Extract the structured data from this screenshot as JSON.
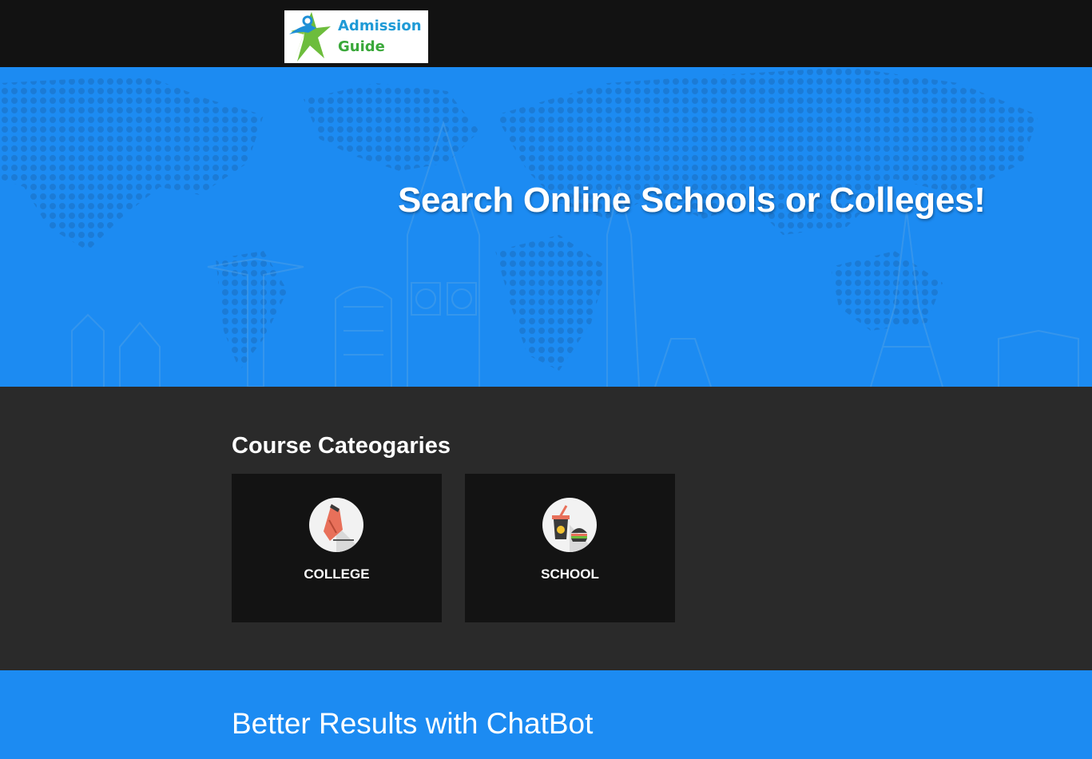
{
  "header": {
    "logo": {
      "line1": "Admission",
      "line2": "Guide",
      "icon": "star-person-logo-icon",
      "colors": {
        "blue": "#1e9ad6",
        "green": "#3aa83a"
      }
    }
  },
  "hero": {
    "title": "Search Online Schools or Colleges!",
    "background_color": "#1c8bf2",
    "background_art": "dotted-world-map-with-landmarks"
  },
  "categories": {
    "heading": "Course Cateogaries",
    "items": [
      {
        "label": "COLLEGE",
        "icon": "fountain-pen-icon"
      },
      {
        "label": "SCHOOL",
        "icon": "drink-and-burger-icon"
      }
    ]
  },
  "chatbot": {
    "title": "Better Results with ChatBot"
  },
  "colors": {
    "top_bar": "#121212",
    "accent_blue": "#1c8bf2",
    "section_dark": "#2a2a2a",
    "card_bg": "#131313"
  }
}
